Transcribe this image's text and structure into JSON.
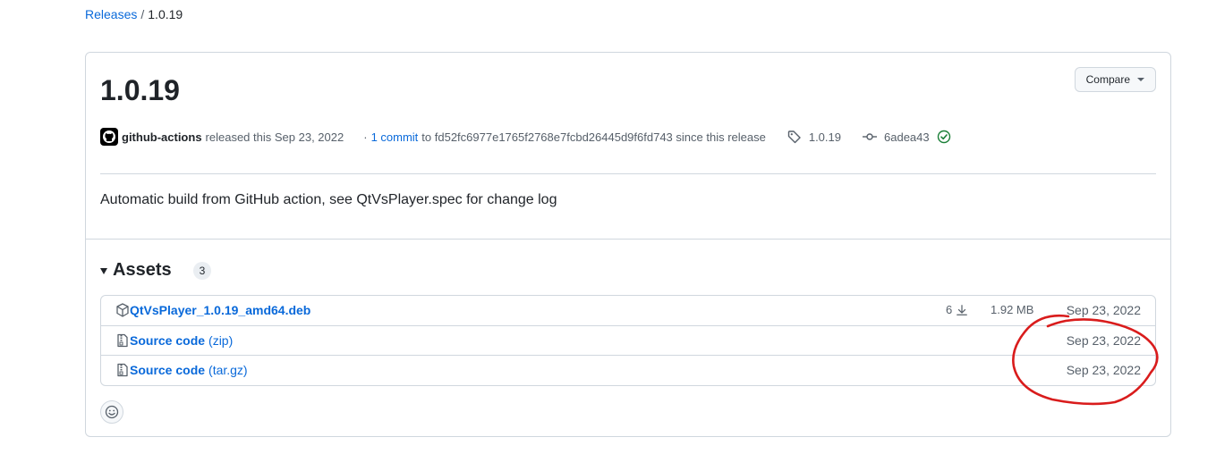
{
  "breadcrumb": {
    "parent": "Releases",
    "separator": "/",
    "current": "1.0.19"
  },
  "release": {
    "title": "1.0.19",
    "compare_label": "Compare",
    "author": "github-actions",
    "released_text": "released this Sep 23, 2022",
    "commits_prefix": "·",
    "commits_link": "1 commit",
    "commits_suffix": "to fd52fc6977e1765f2768e7fcbd26445d9f6fd743 since this release",
    "tag": "1.0.19",
    "commit_sha": "6adea43",
    "description": "Automatic build from GitHub action, see QtVsPlayer.spec for change log"
  },
  "assets": {
    "label": "Assets",
    "count": "3",
    "items": [
      {
        "name": "QtVsPlayer_1.0.19_amd64.deb",
        "suffix": "",
        "downloads": "6",
        "size": "1.92 MB",
        "date": "Sep 23, 2022",
        "icon": "package-icon"
      },
      {
        "name": "Source code",
        "suffix": "(zip)",
        "downloads": "",
        "size": "",
        "date": "Sep 23, 2022",
        "icon": "file-zip-icon"
      },
      {
        "name": "Source code",
        "suffix": "(tar.gz)",
        "downloads": "",
        "size": "",
        "date": "Sep 23, 2022",
        "icon": "file-zip-icon"
      }
    ]
  },
  "colors": {
    "link": "#0969da",
    "annotation": "#d91c1c",
    "check": "#1a7f37"
  }
}
